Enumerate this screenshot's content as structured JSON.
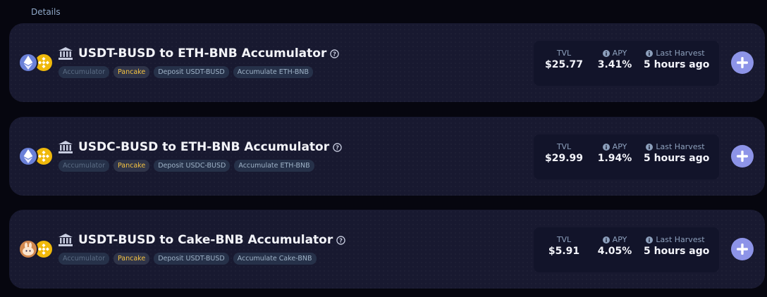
{
  "header": {
    "details_label": "Details"
  },
  "colors": {
    "accent": "#8d94e8",
    "card_bg": "#181930",
    "tag_yellow": "#f5c342",
    "bnb": "#f0b90b"
  },
  "stat_labels": {
    "tvl": "TVL",
    "apy": "APY",
    "last_harvest": "Last Harvest"
  },
  "vaults": [
    {
      "title": "USDT-BUSD to ETH-BNB Accumulator",
      "coin1_icon": "eth-icon",
      "coin2_icon": "bnb-icon",
      "tags": [
        "Accumulator",
        "Pancake",
        "Deposit USDT-BUSD",
        "Accumulate ETH-BNB"
      ],
      "tvl": "$25.77",
      "apy": "3.41%",
      "last_harvest": "5 hours ago"
    },
    {
      "title": "USDC-BUSD to ETH-BNB Accumulator",
      "coin1_icon": "eth-icon",
      "coin2_icon": "bnb-icon",
      "tags": [
        "Accumulator",
        "Pancake",
        "Deposit USDC-BUSD",
        "Accumulate ETH-BNB"
      ],
      "tvl": "$29.99",
      "apy": "1.94%",
      "last_harvest": "5 hours ago"
    },
    {
      "title": "USDT-BUSD to Cake-BNB Accumulator",
      "coin1_icon": "cake-icon",
      "coin2_icon": "bnb-icon",
      "tags": [
        "Accumulator",
        "Pancake",
        "Deposit USDT-BUSD",
        "Accumulate Cake-BNB"
      ],
      "tvl": "$5.91",
      "apy": "4.05%",
      "last_harvest": "5 hours ago"
    }
  ]
}
